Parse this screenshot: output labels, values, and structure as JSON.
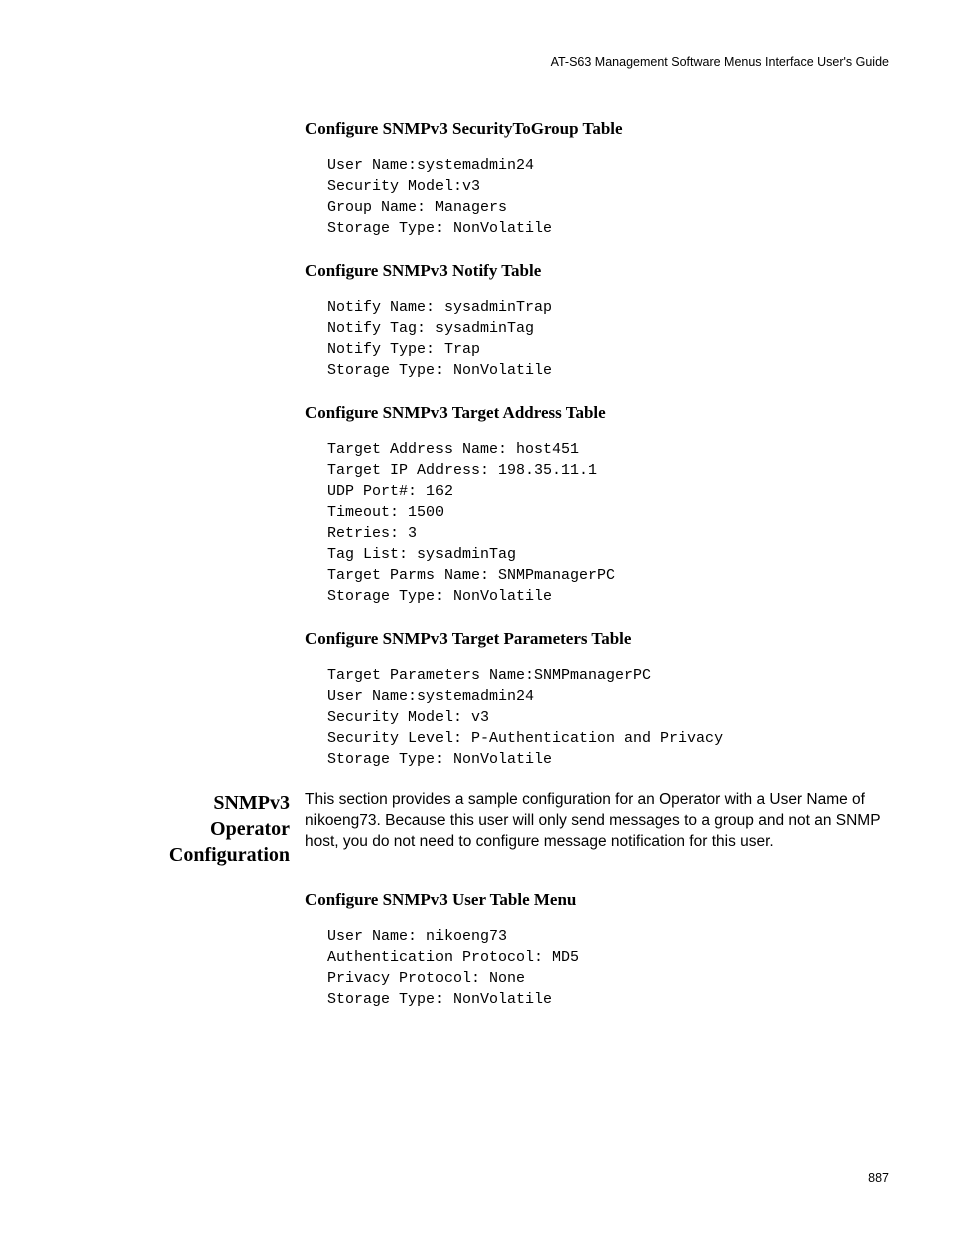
{
  "header": "AT-S63 Management Software Menus Interface User's Guide",
  "sections": {
    "s1": {
      "heading": "Configure SNMPv3 SecurityToGroup Table",
      "code": "User Name:systemadmin24\nSecurity Model:v3\nGroup Name: Managers\nStorage Type: NonVolatile"
    },
    "s2": {
      "heading": "Configure SNMPv3 Notify Table",
      "code": "Notify Name: sysadminTrap\nNotify Tag: sysadminTag\nNotify Type: Trap\nStorage Type: NonVolatile"
    },
    "s3": {
      "heading": "Configure SNMPv3 Target Address Table",
      "code": "Target Address Name: host451\nTarget IP Address: 198.35.11.1\nUDP Port#: 162\nTimeout: 1500\nRetries: 3\nTag List: sysadminTag\nTarget Parms Name: SNMPmanagerPC\nStorage Type: NonVolatile"
    },
    "s4": {
      "heading": "Configure SNMPv3 Target Parameters Table",
      "code": "Target Parameters Name:SNMPmanagerPC\nUser Name:systemadmin24\nSecurity Model: v3\nSecurity Level: P-Authentication and Privacy\nStorage Type: NonVolatile"
    },
    "s5": {
      "heading": "Configure SNMPv3 User Table Menu",
      "code": "User Name: nikoeng73\nAuthentication Protocol: MD5\nPrivacy Protocol: None\nStorage Type: NonVolatile"
    }
  },
  "sideSection": {
    "heading": "SNMPv3 Operator Configuration",
    "paragraph": "This section provides a sample configuration for an Operator with a User Name of nikoeng73. Because this user will only send messages to a group and not an SNMP host, you do not need to configure message notification for this user."
  },
  "pageNumber": "887"
}
